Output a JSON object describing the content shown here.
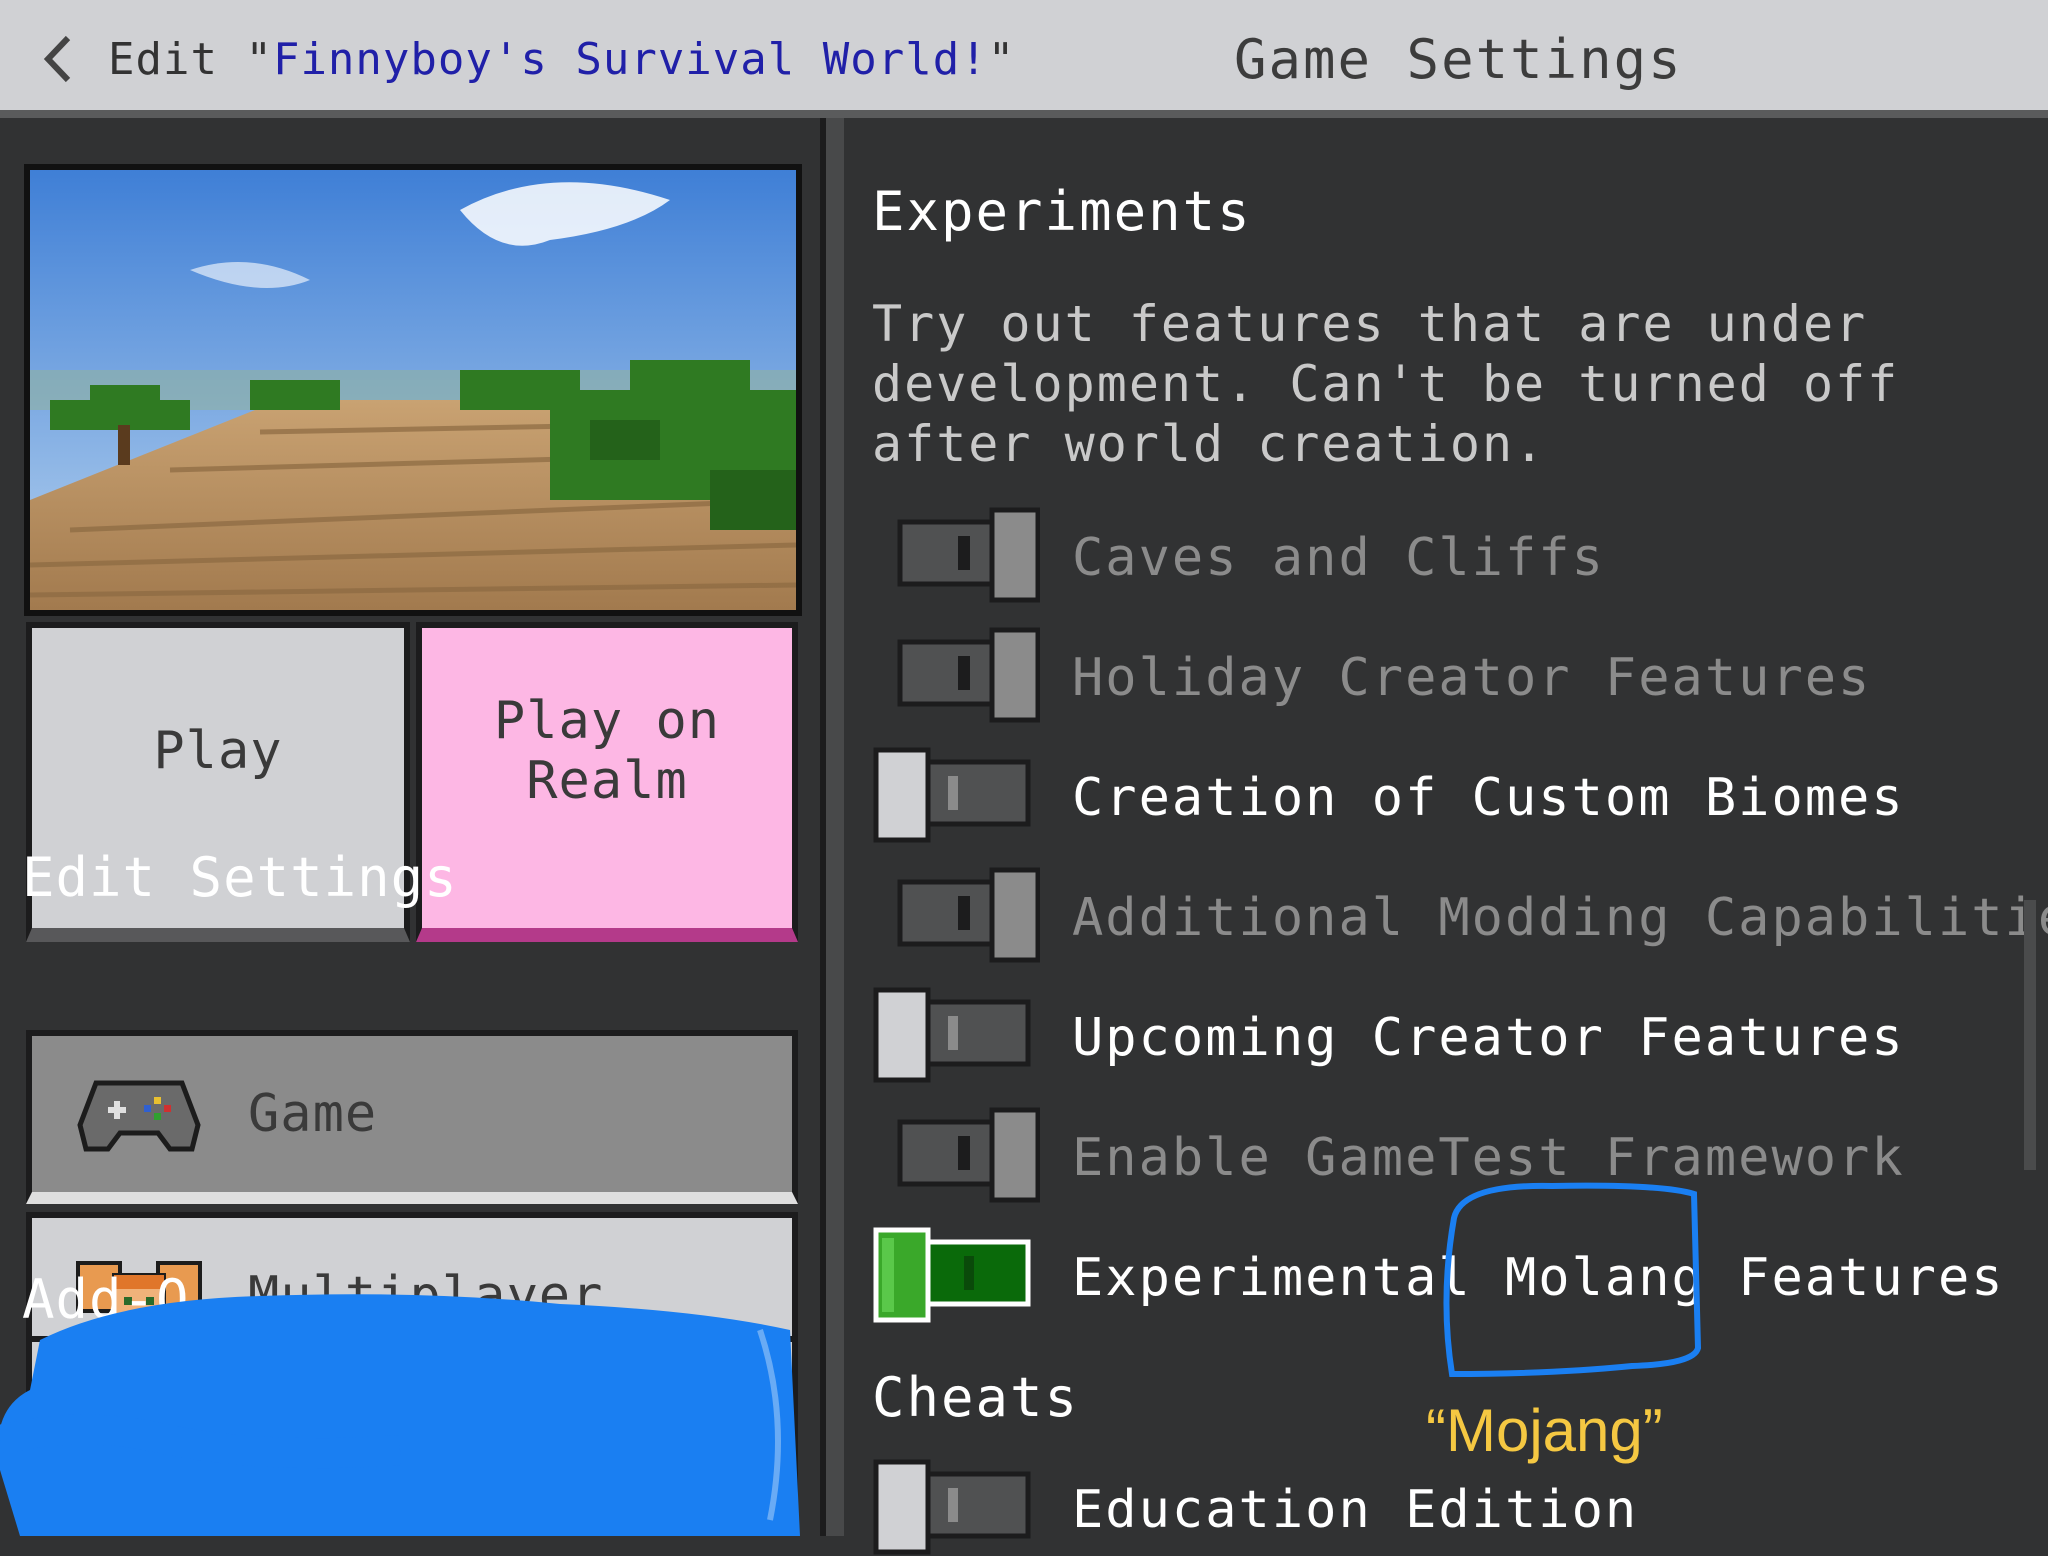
{
  "header": {
    "edit_prefix": "Edit \"",
    "world_name": "Finnyboy's Survival World!",
    "edit_suffix": "\"",
    "title": "Game Settings"
  },
  "left": {
    "play_label": "Play",
    "realm_label_line1": "Play on",
    "realm_label_line2": "Realm",
    "edit_settings_heading": "Edit Settings",
    "nav": [
      {
        "label": "Game",
        "icon": "controller-icon"
      },
      {
        "label": "Multiplayer",
        "icon": "players-icon"
      }
    ],
    "addons_heading_partial": "Add-O"
  },
  "experiments": {
    "heading": "Experiments",
    "description": "Try out features that are under development. Can't be turned off after world creation.",
    "toggles": [
      {
        "label": "Caves and Cliffs",
        "state": "on",
        "disabled": true
      },
      {
        "label": "Holiday Creator Features",
        "state": "on",
        "disabled": true
      },
      {
        "label": "Creation of Custom Biomes",
        "state": "off",
        "disabled": false
      },
      {
        "label": "Additional Modding Capabilities",
        "state": "on",
        "disabled": true
      },
      {
        "label": "Upcoming Creator Features",
        "state": "off",
        "disabled": false
      },
      {
        "label": "Enable GameTest Framework",
        "state": "on",
        "disabled": true
      },
      {
        "label": "Experimental Molang Features",
        "state": "on-active",
        "disabled": false
      }
    ]
  },
  "cheats": {
    "heading": "Cheats",
    "toggles": [
      {
        "label": "Education Edition",
        "state": "off",
        "disabled": false
      }
    ]
  },
  "annotation": {
    "text": "“Mojang”",
    "color": "#f5c842"
  },
  "colors": {
    "scribble": "#1a7ff2",
    "realm_button": "#fdb7e4",
    "toggle_active": "#2a8a1a"
  }
}
